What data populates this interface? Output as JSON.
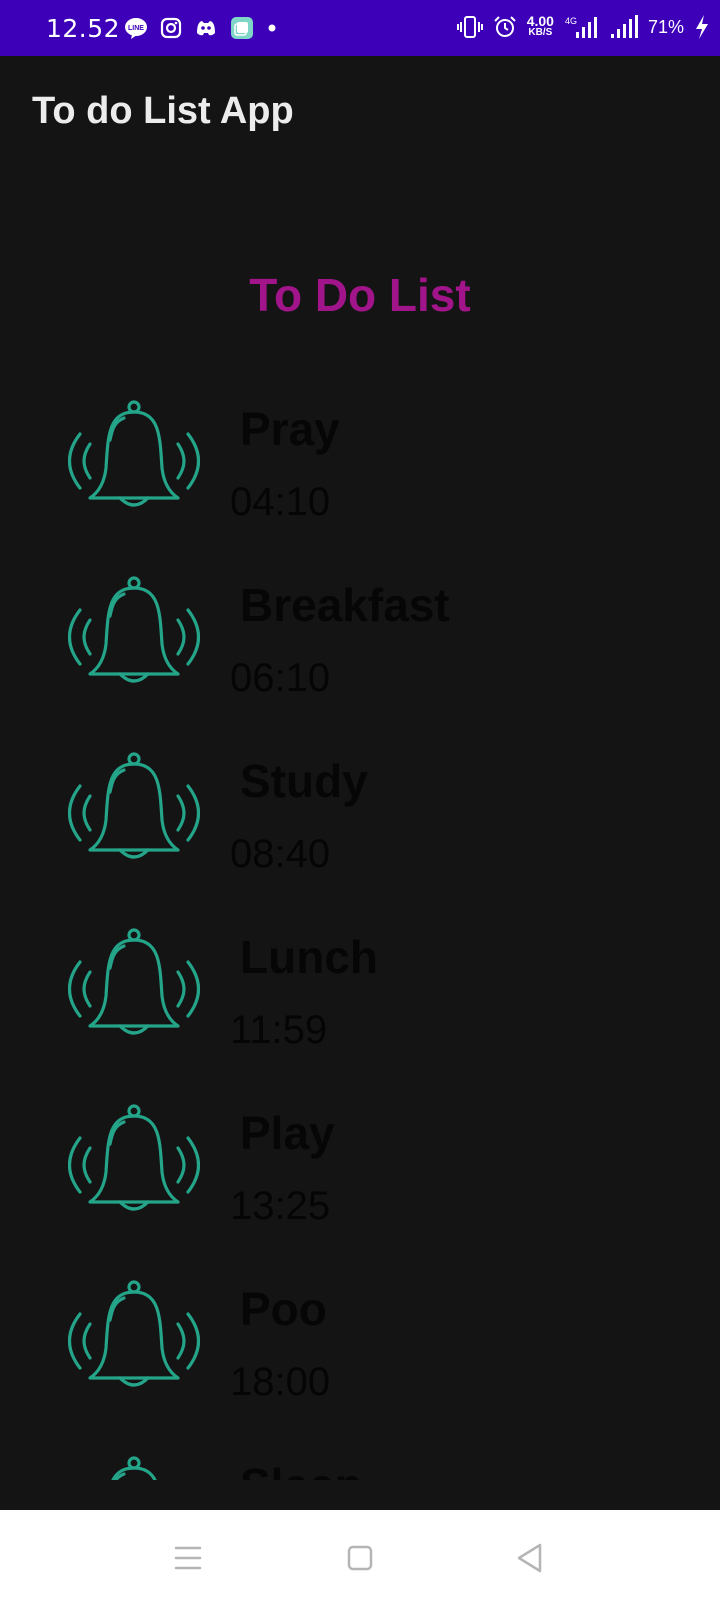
{
  "status_bar": {
    "time": "12.52",
    "left_icons": [
      "line-icon",
      "instagram-icon",
      "discord-icon",
      "app-icon",
      "dot-icon"
    ],
    "speed_value": "4.00",
    "speed_unit": "KB/S",
    "network": "4G",
    "battery": "71%",
    "background": "#3d00b8"
  },
  "app_bar": {
    "title": "To do List App"
  },
  "heading": {
    "text": "To Do List",
    "color": "#a2158a"
  },
  "tasks": [
    {
      "name": "Pray",
      "time": "04:10",
      "icon": "bell-ringing-icon"
    },
    {
      "name": "Breakfast",
      "time": "06:10",
      "icon": "bell-ringing-icon"
    },
    {
      "name": "Study",
      "time": "08:40",
      "icon": "bell-ringing-icon"
    },
    {
      "name": "Lunch",
      "time": "11:59",
      "icon": "bell-ringing-icon"
    },
    {
      "name": "Play",
      "time": "13:25",
      "icon": "bell-ringing-icon"
    },
    {
      "name": "Poo",
      "time": "18:00",
      "icon": "bell-ringing-icon"
    },
    {
      "name": "Sleep",
      "time": "",
      "icon": "bell-ringing-icon"
    }
  ],
  "bell_color": "#24a58a",
  "nav_bar": {
    "buttons": [
      "menu-icon",
      "home-icon",
      "back-icon"
    ]
  }
}
